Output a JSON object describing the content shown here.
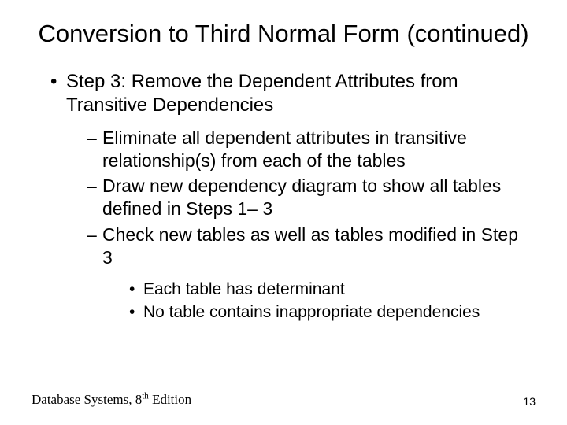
{
  "title": "Conversion to Third Normal Form (continued)",
  "level1": {
    "bullet": "•",
    "text": "Step 3: Remove the Dependent Attributes from Transitive Dependencies"
  },
  "level2": [
    {
      "bullet": "–",
      "text": "Eliminate all dependent attributes in transitive relationship(s) from each of the tables"
    },
    {
      "bullet": "–",
      "text": "Draw new dependency diagram to show all tables defined in Steps 1– 3"
    },
    {
      "bullet": "–",
      "text": "Check new tables as well as tables modified in Step 3"
    }
  ],
  "level3": [
    {
      "bullet": "•",
      "text": "Each table has determinant"
    },
    {
      "bullet": "•",
      "text": "No table contains inappropriate dependencies"
    }
  ],
  "footer": {
    "book_prefix": "Database Systems, 8",
    "book_sup": "th",
    "book_suffix": " Edition",
    "page": "13"
  }
}
